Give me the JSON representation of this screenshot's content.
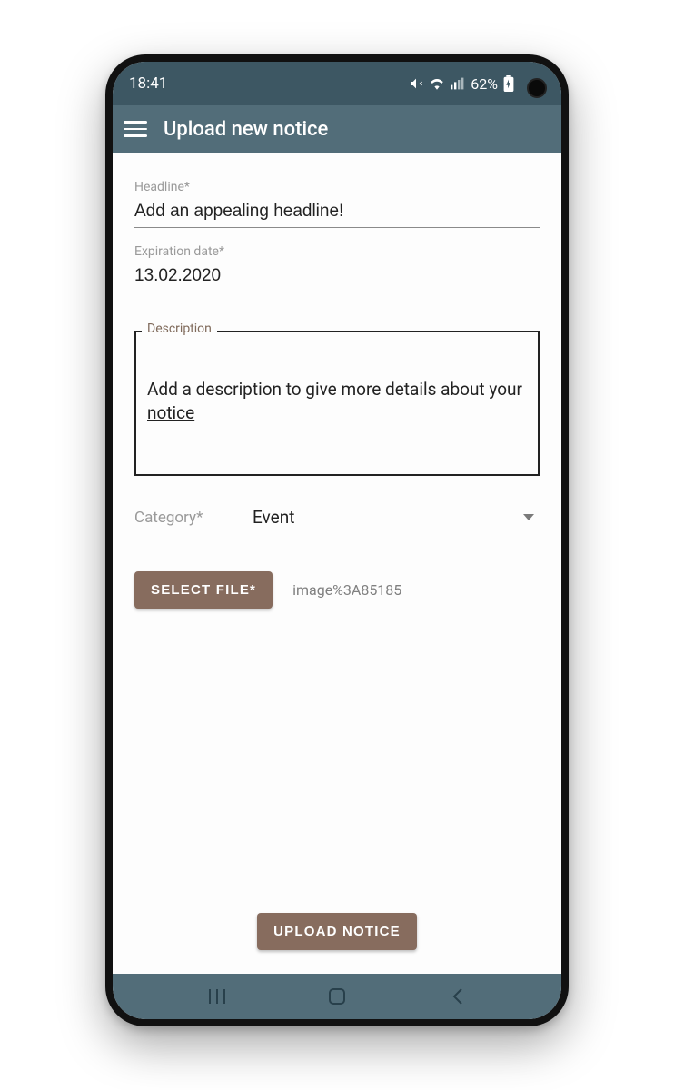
{
  "status": {
    "time": "18:41",
    "battery_text": "62%"
  },
  "appbar": {
    "title": "Upload new notice"
  },
  "form": {
    "headline": {
      "label": "Headline*",
      "value": "Add an appealing headline!"
    },
    "expiration": {
      "label": "Expiration date*",
      "value": "13.02.2020"
    },
    "description": {
      "label": "Description",
      "value_prefix": "Add a description to give more details about your ",
      "value_underlined": "notice"
    },
    "category": {
      "label": "Category*",
      "selected": "Event"
    },
    "file": {
      "button_label": "SELECT FILE*",
      "file_name": "image%3A85185"
    },
    "submit_label": "UPLOAD NOTICE"
  }
}
